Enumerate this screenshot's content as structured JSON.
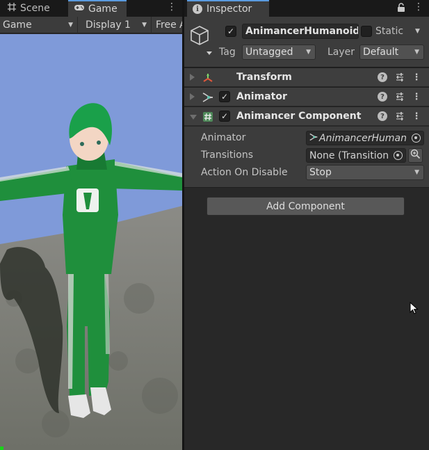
{
  "left_panel": {
    "tabs": [
      {
        "label": "Scene",
        "icon": "grid-icon"
      },
      {
        "label": "Game",
        "icon": "gamepad-icon"
      }
    ],
    "toolbar": {
      "view_mode": "Game",
      "display": "Display 1",
      "aspect": "Free A"
    }
  },
  "inspector": {
    "tab_label": "Inspector",
    "object": {
      "name": "AnimancerHumanoid",
      "active": true,
      "static_label": "Static",
      "tag_label": "Tag",
      "tag_value": "Untagged",
      "layer_label": "Layer",
      "layer_value": "Default"
    },
    "components": [
      {
        "title": "Transform",
        "icon": "transform-axes-icon",
        "expanded": false
      },
      {
        "title": "Animator",
        "icon": "animator-icon",
        "expanded": false,
        "enabled": true
      },
      {
        "title": "Animancer Component",
        "icon": "script-hash-icon",
        "expanded": true,
        "enabled": true
      }
    ],
    "animancer_fields": {
      "animator_label": "Animator",
      "animator_value": "AnimancerHuman",
      "transitions_label": "Transitions",
      "transitions_value": "None (Transition",
      "action_on_disable_label": "Action On Disable",
      "action_on_disable_value": "Stop"
    },
    "add_component_label": "Add Component"
  },
  "colors": {
    "accent_tab": "#5a9be0",
    "sky": "#7f9ad9",
    "tracksuit": "#1f8f3c",
    "hair": "#1aa04a"
  }
}
